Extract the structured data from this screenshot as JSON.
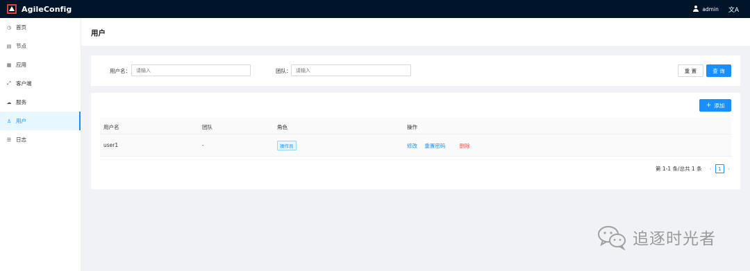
{
  "app": {
    "name": "AgileConfig"
  },
  "header": {
    "username": "admin",
    "lang_icon": "文A"
  },
  "sidebar": {
    "items": [
      {
        "label": "首页",
        "icon": "dashboard-icon",
        "glyph": "◷"
      },
      {
        "label": "节点",
        "icon": "node-icon",
        "glyph": "▤"
      },
      {
        "label": "应用",
        "icon": "app-grid-icon",
        "glyph": "▦"
      },
      {
        "label": "客户端",
        "icon": "client-icon",
        "glyph": "⤢"
      },
      {
        "label": "服务",
        "icon": "cloud-icon",
        "glyph": "☁"
      },
      {
        "label": "用户",
        "icon": "user-icon",
        "glyph": "♙",
        "active": true
      },
      {
        "label": "日志",
        "icon": "list-icon",
        "glyph": "☰"
      }
    ]
  },
  "page": {
    "title": "用户"
  },
  "search": {
    "username_label": "用户名：",
    "username_placeholder": "请输入",
    "team_label": "团队：",
    "team_placeholder": "请输入",
    "reset_label": "重 置",
    "query_label": "查 询"
  },
  "table": {
    "add_label": "添加",
    "columns": [
      "用户名",
      "团队",
      "角色",
      "操作"
    ],
    "rows": [
      {
        "username": "user1",
        "team": "-",
        "role": "操作员",
        "actions": [
          "修改",
          "重置密码",
          "删除"
        ]
      }
    ]
  },
  "pagination": {
    "total_text": "第 1-1 条/总共 1 条",
    "current_page": "1",
    "prev": "‹",
    "next": "›"
  },
  "watermark": {
    "text": "追逐时光者"
  }
}
